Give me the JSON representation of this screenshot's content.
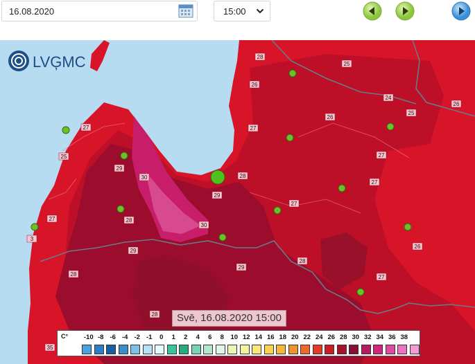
{
  "controls": {
    "date_value": "16.08.2020",
    "time_value": "15:00",
    "calendar_icon": "calendar-icon",
    "prev_icon": "arrow-left-icon",
    "next_icon": "arrow-right-icon",
    "play_icon": "play-icon"
  },
  "map": {
    "logo_text": "LVĢMC",
    "caption": "Svē, 16.08.2020 15:00",
    "isotherm_labels": [
      "28",
      "25",
      "26",
      "24",
      "25",
      "26",
      "27",
      "26",
      "27",
      "27",
      "25",
      "29",
      "30",
      "28",
      "27",
      "29",
      "28",
      "30",
      "27",
      "26",
      "27",
      "3",
      "29",
      "29",
      "28",
      "28",
      "27",
      "28",
      "35"
    ],
    "station_count": 14
  },
  "legend": {
    "unit": "C°",
    "labels": [
      "-10",
      "-8",
      "-6",
      "-4",
      "-2",
      "-1",
      "0",
      "1",
      "2",
      "4",
      "6",
      "8",
      "10",
      "12",
      "14",
      "16",
      "18",
      "20",
      "22",
      "24",
      "26",
      "28",
      "30",
      "32",
      "34",
      "36",
      "38"
    ],
    "colors": [
      "#4aa3df",
      "#2c7fc4",
      "#1c5fa0",
      "#3c8fc4",
      "#7cc0e8",
      "#b6e0f4",
      "#e6f7fd",
      "#3cc39a",
      "#2aa97e",
      "#79d3b2",
      "#b5e6cd",
      "#dff5e8",
      "#eaf6b5",
      "#f6f3a0",
      "#fbe57a",
      "#fdd14e",
      "#f9b43a",
      "#f4902f",
      "#ef6a2a",
      "#e53a26",
      "#cf1c22",
      "#a8132a",
      "#8a0f34",
      "#b51a63",
      "#d4267c",
      "#e14aa0",
      "#ed73c1",
      "#f49bd6"
    ]
  }
}
